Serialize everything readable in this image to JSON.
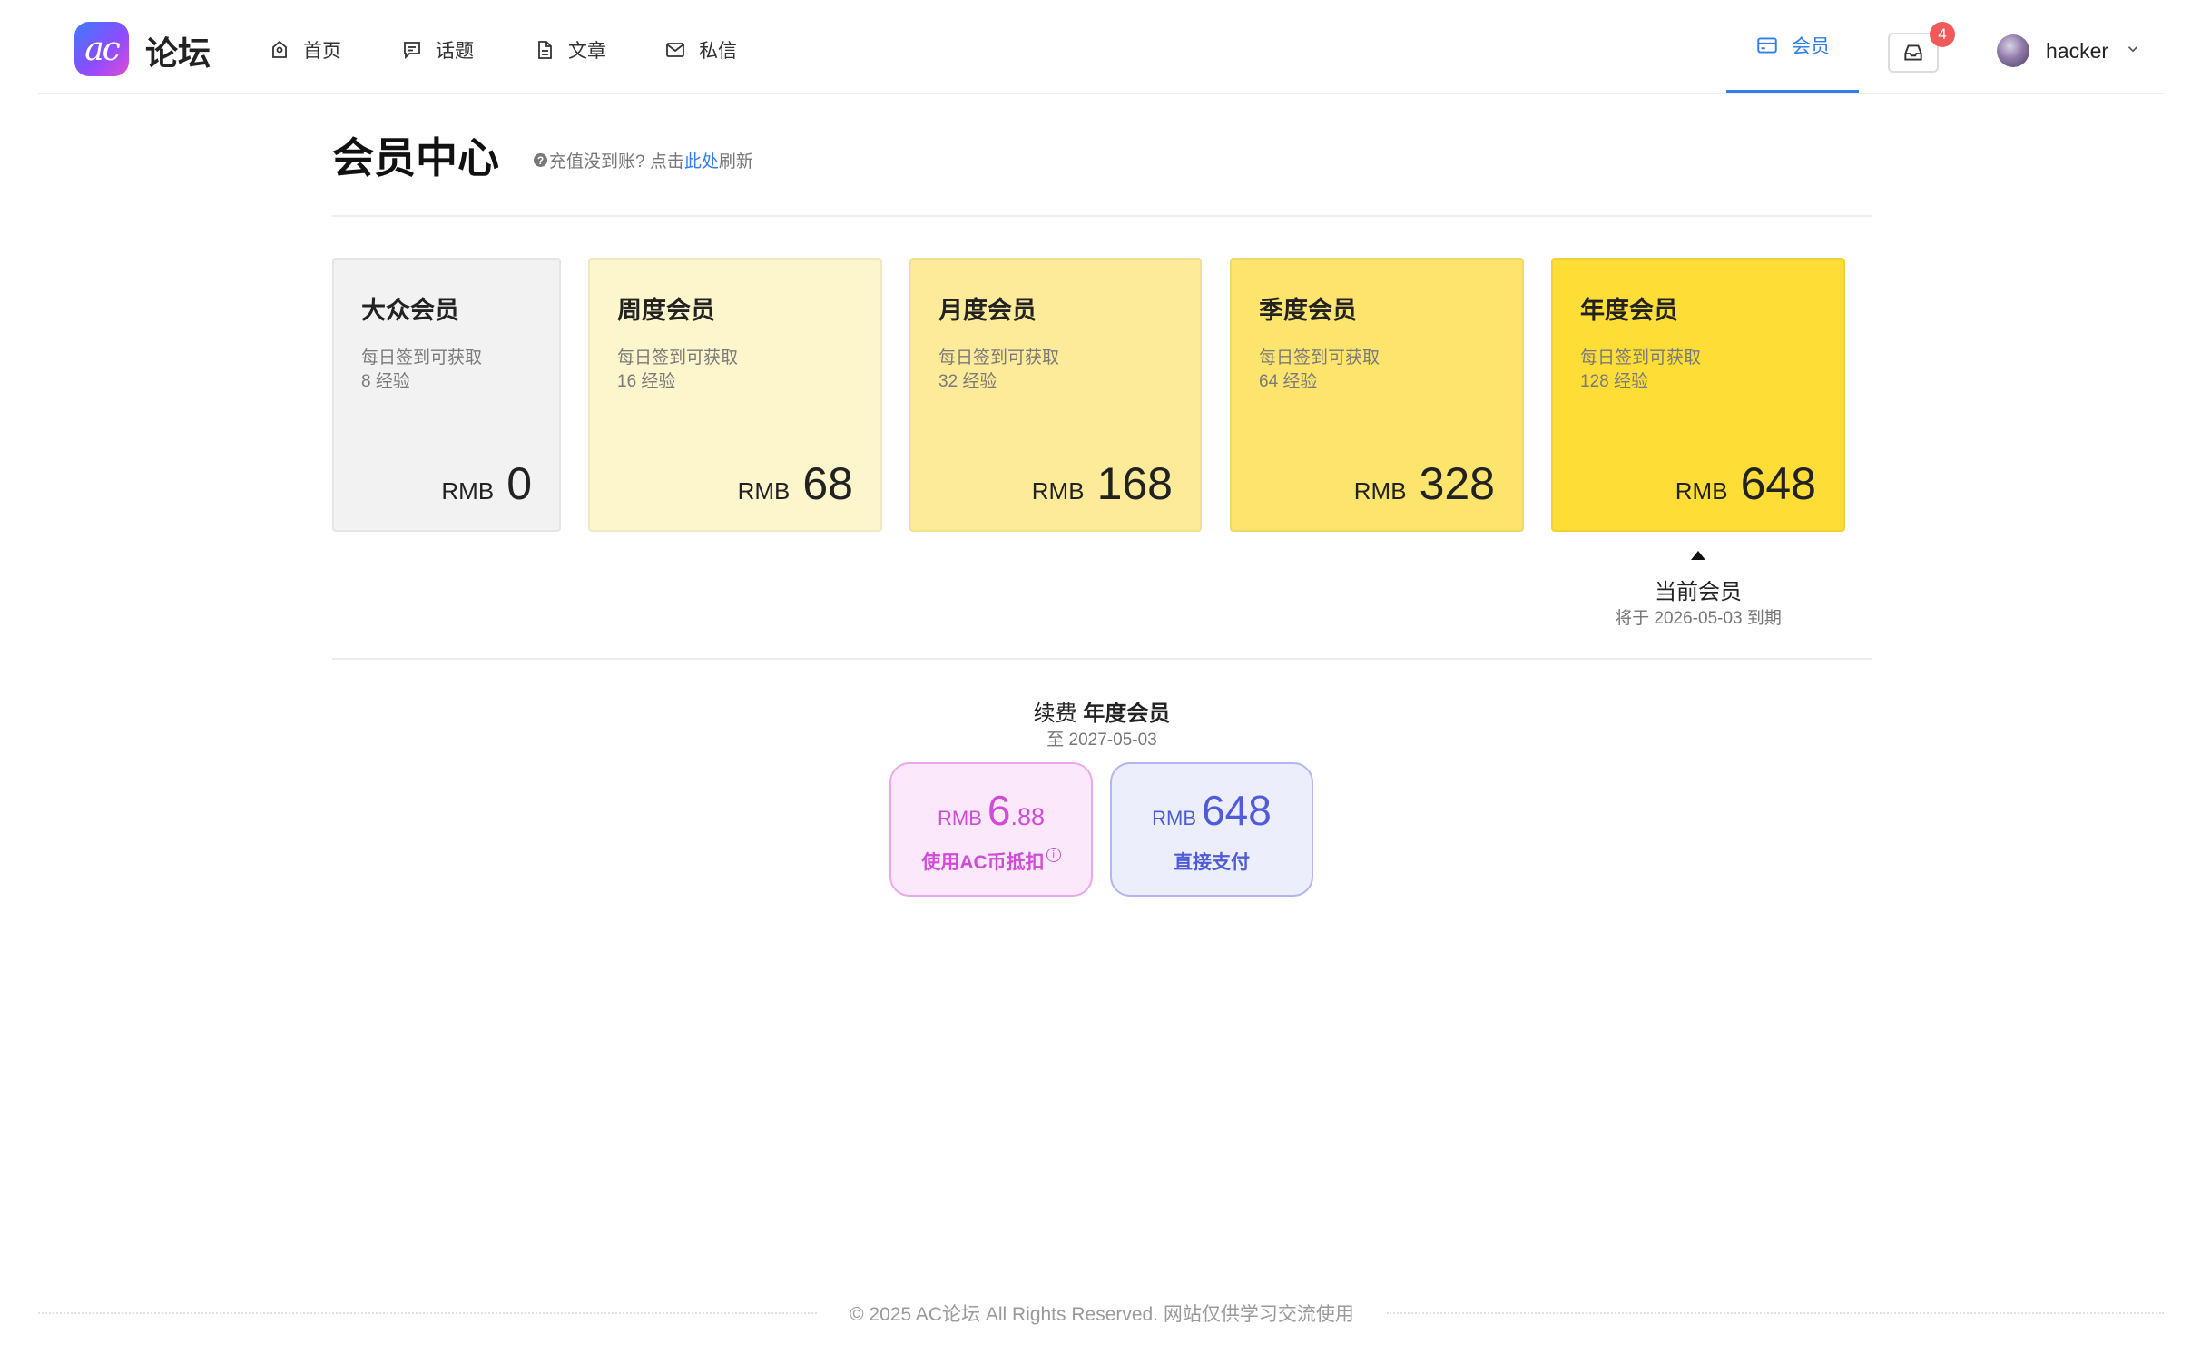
{
  "header": {
    "logo_mark": "ac",
    "logo_text": "论坛",
    "nav": [
      {
        "label": "首页",
        "icon": "home-icon"
      },
      {
        "label": "话题",
        "icon": "chat-icon"
      },
      {
        "label": "文章",
        "icon": "document-icon"
      },
      {
        "label": "私信",
        "icon": "mail-icon"
      }
    ],
    "member_tab": "会员",
    "inbox_badge": "4",
    "username": "hacker",
    "accent_color": "#2f7ff0"
  },
  "page": {
    "title": "会员中心",
    "note_prefix": "充值没到账? 点击",
    "note_link": "此处",
    "note_suffix": "刷新"
  },
  "tiers": [
    {
      "name": "大众会员",
      "desc_line1": "每日签到可获取",
      "desc_line2": "8 经验",
      "currency": "RMB",
      "price": "0",
      "color": "#f2f2f2"
    },
    {
      "name": "周度会员",
      "desc_line1": "每日签到可获取",
      "desc_line2": "16 经验",
      "currency": "RMB",
      "price": "68",
      "color": "#fdf5cc"
    },
    {
      "name": "月度会员",
      "desc_line1": "每日签到可获取",
      "desc_line2": "32 经验",
      "currency": "RMB",
      "price": "168",
      "color": "#feeb9a"
    },
    {
      "name": "季度会员",
      "desc_line1": "每日签到可获取",
      "desc_line2": "64 经验",
      "currency": "RMB",
      "price": "328",
      "color": "#fde46c"
    },
    {
      "name": "年度会员",
      "desc_line1": "每日签到可获取",
      "desc_line2": "128 经验",
      "currency": "RMB",
      "price": "648",
      "color": "#fedd37"
    }
  ],
  "current": {
    "label": "当前会员",
    "expiry": "将于 2026-05-03 到期"
  },
  "renew": {
    "prefix": "续费",
    "tier": "年度会员",
    "until": "至 2027-05-03",
    "ac_option": {
      "currency": "RMB",
      "int": "6",
      "dec": ".88",
      "label": "使用AC币抵扣",
      "info": "i"
    },
    "direct_option": {
      "currency": "RMB",
      "int": "648",
      "label": "直接支付"
    }
  },
  "footer": {
    "text": "© 2025 AC论坛 All Rights Reserved. 网站仅供学习交流使用"
  }
}
